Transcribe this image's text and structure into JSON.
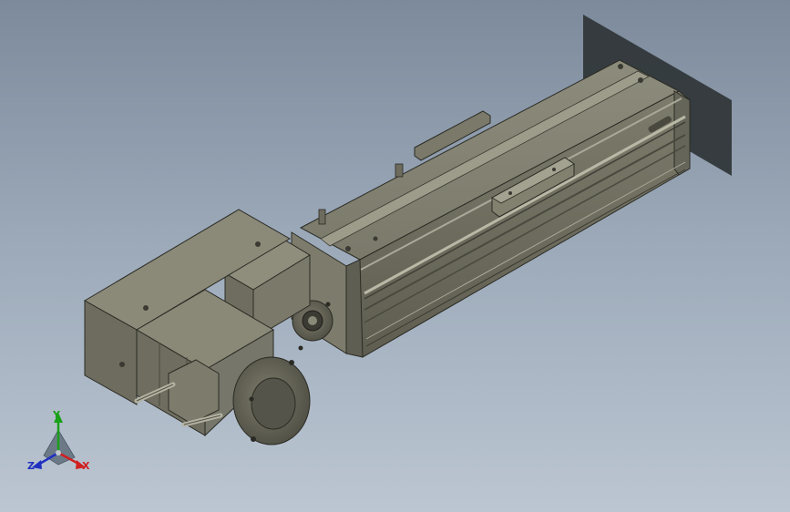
{
  "viewport": {
    "background_top": "#7c8a9b",
    "background_bottom": "#bcc6d2",
    "model_color": "#6f6e5f",
    "wall_color": "#2f3436"
  },
  "triad": {
    "y_label": "Y",
    "x_label": "X",
    "z_label": "Z",
    "y_color": "#18a018",
    "x_color": "#d02020",
    "z_color": "#2030c0"
  }
}
